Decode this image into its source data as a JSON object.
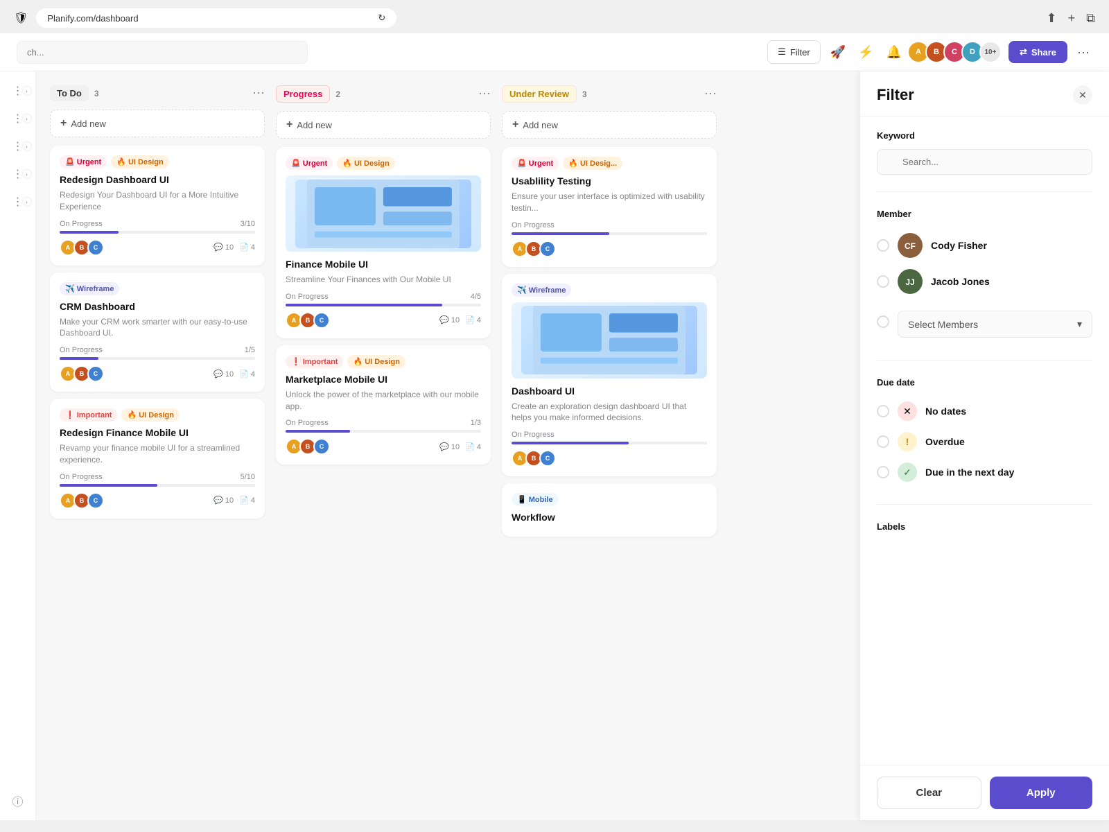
{
  "browser": {
    "url": "Planify.com/dashboard",
    "shield_icon": "🛡",
    "reload_icon": "↻"
  },
  "header": {
    "search_placeholder": "ch...",
    "filter_label": "Filter",
    "share_label": "Share",
    "avatar_count": "10+",
    "avatars": [
      {
        "color": "#e8a020",
        "initials": "A"
      },
      {
        "color": "#c45020",
        "initials": "B"
      },
      {
        "color": "#d04060",
        "initials": "C"
      },
      {
        "color": "#40a0c0",
        "initials": "D"
      }
    ]
  },
  "board": {
    "columns": [
      {
        "id": "todo",
        "label": "To Do",
        "count": 3,
        "label_class": "label-todo",
        "cards": [
          {
            "id": "card-1",
            "tags": [
              {
                "text": "🚨 Urgent",
                "class": "tag-urgent"
              },
              {
                "text": "🔥 UI Design",
                "class": "tag-uidesign"
              }
            ],
            "title": "Redesign Dashboard UI",
            "desc": "Redesign Your Dashboard UI for a More Intuitive Experience",
            "progress_label": "On Progress",
            "progress_value": "3/10",
            "progress_pct": 30,
            "avatars": [
              "#e8a020",
              "#c45020",
              "#4080d0"
            ],
            "comments": 10,
            "files": 4
          },
          {
            "id": "card-2",
            "tags": [
              {
                "text": "✈️ Wireframe",
                "class": "tag-wireframe"
              }
            ],
            "title": "CRM Dashboard",
            "desc": "Make your CRM work smarter with our easy-to-use Dashboard UI.",
            "progress_label": "On Progress",
            "progress_value": "1/5",
            "progress_pct": 20,
            "avatars": [
              "#e8a020",
              "#c45020",
              "#4080d0"
            ],
            "comments": 10,
            "files": 4
          },
          {
            "id": "card-3",
            "tags": [
              {
                "text": "❗ Important",
                "class": "tag-important"
              },
              {
                "text": "🔥 UI Design",
                "class": "tag-uidesign"
              }
            ],
            "title": "Redesign Finance Mobile UI",
            "desc": "Revamp your finance mobile UI for a streamlined experience.",
            "progress_label": "On Progress",
            "progress_value": "5/10",
            "progress_pct": 50,
            "avatars": [
              "#e8a020",
              "#c45020",
              "#4080d0"
            ],
            "comments": 10,
            "files": 4
          }
        ]
      },
      {
        "id": "progress",
        "label": "Progress",
        "count": 2,
        "label_class": "label-progress",
        "cards": [
          {
            "id": "card-4",
            "has_image": true,
            "tags": [
              {
                "text": "🚨 Urgent",
                "class": "tag-urgent"
              },
              {
                "text": "🔥 UI Design",
                "class": "tag-uidesign"
              }
            ],
            "title": "Finance Mobile UI",
            "desc": "Streamline Your Finances with Our Mobile UI",
            "progress_label": "On Progress",
            "progress_value": "4/5",
            "progress_pct": 80,
            "avatars": [
              "#e8a020",
              "#c45020",
              "#4080d0"
            ],
            "comments": 10,
            "files": 4
          },
          {
            "id": "card-5",
            "tags": [
              {
                "text": "❗ Important",
                "class": "tag-important"
              },
              {
                "text": "🔥 UI Design",
                "class": "tag-uidesign"
              }
            ],
            "title": "Marketplace Mobile UI",
            "desc": "Unlock the power of the marketplace with our mobile app.",
            "progress_label": "On Progress",
            "progress_value": "1/3",
            "progress_pct": 33,
            "avatars": [
              "#e8a020",
              "#c45020",
              "#4080d0"
            ],
            "comments": 10,
            "files": 4
          }
        ]
      },
      {
        "id": "review",
        "label": "Under Review",
        "count": 3,
        "label_class": "label-review",
        "cards": [
          {
            "id": "card-6",
            "tags": [
              {
                "text": "🚨 Urgent",
                "class": "tag-urgent"
              },
              {
                "text": "🔥 UI Desig...",
                "class": "tag-uidesign"
              }
            ],
            "title": "Usablility Testing",
            "desc": "Ensure your user interface is optimized with usability testin...",
            "progress_label": "On Progress",
            "progress_value": "",
            "progress_pct": 50,
            "avatars": [
              "#e8a020",
              "#c45020",
              "#4080d0"
            ],
            "comments": "",
            "files": ""
          },
          {
            "id": "card-7",
            "has_image": true,
            "tags": [
              {
                "text": "✈️ Wireframe",
                "class": "tag-wireframe"
              }
            ],
            "title": "Dashboard UI",
            "desc": "Create an exploration design dashboard UI that helps you make informed decisions.",
            "progress_label": "On Progress",
            "progress_value": "",
            "progress_pct": 60,
            "avatars": [
              "#e8a020",
              "#c45020",
              "#4080d0"
            ],
            "comments": "",
            "files": ""
          },
          {
            "id": "card-8",
            "tags": [
              {
                "text": "📱 Mobile",
                "class": "tag-mobile"
              }
            ],
            "title": "Workflow",
            "desc": "",
            "progress_label": "",
            "progress_value": "",
            "progress_pct": 0,
            "avatars": [],
            "comments": "",
            "files": ""
          }
        ]
      }
    ]
  },
  "filter": {
    "title": "Filter",
    "keyword_section": "Keyword",
    "keyword_placeholder": "Search...",
    "member_section": "Member",
    "members": [
      {
        "name": "Cody Fisher",
        "avatar_color": "#8B5E3C",
        "initials": "CF"
      },
      {
        "name": "Jacob Jones",
        "avatar_color": "#4A6741",
        "initials": "JJ"
      }
    ],
    "select_members_label": "Select Members",
    "due_date_section": "Due date",
    "due_dates": [
      {
        "label": "No dates",
        "icon": "✕",
        "icon_class": "due-no-dates"
      },
      {
        "label": "Overdue",
        "icon": "!",
        "icon_class": "due-overdue"
      },
      {
        "label": "Due in the next day",
        "icon": "✓",
        "icon_class": "due-next-day"
      }
    ],
    "labels_section": "Labels",
    "clear_label": "Clear",
    "apply_label": "Apply"
  }
}
